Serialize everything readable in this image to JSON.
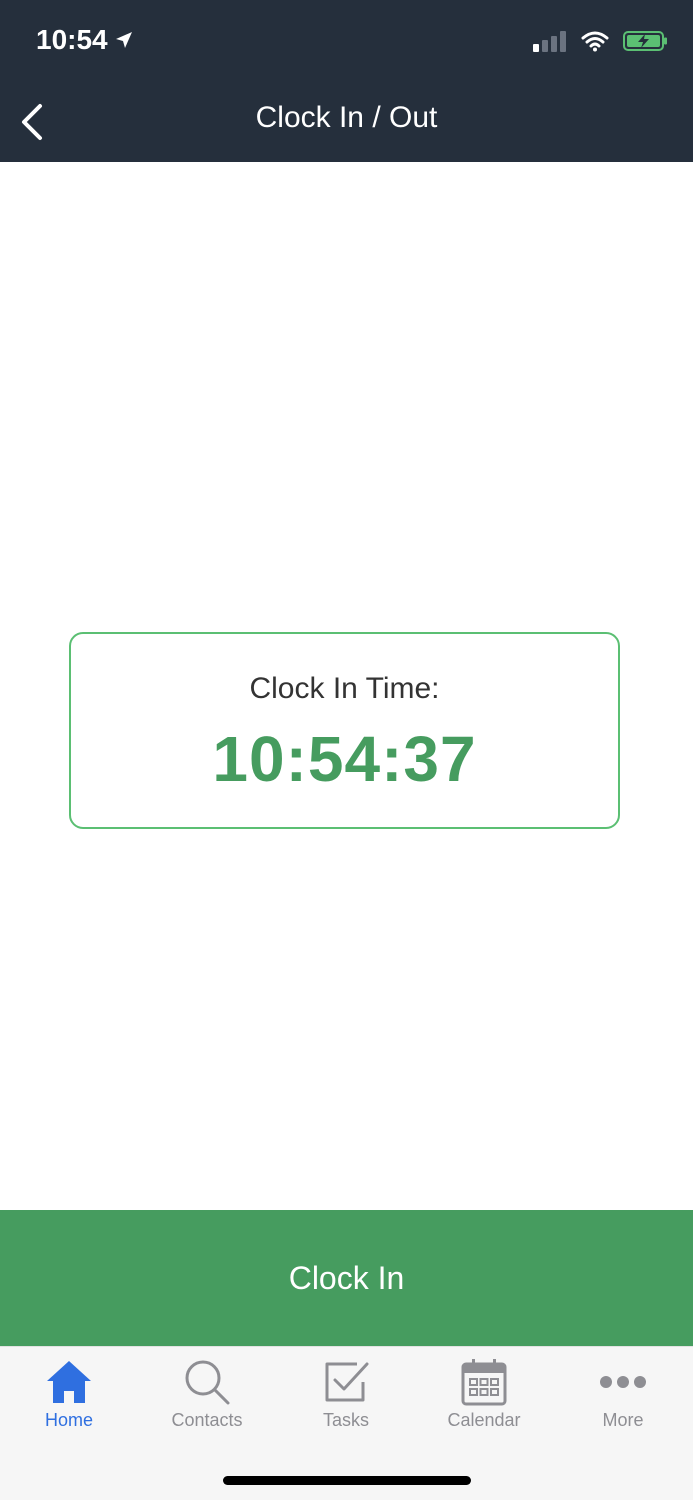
{
  "status_bar": {
    "time": "10:54"
  },
  "nav": {
    "title": "Clock In / Out"
  },
  "card": {
    "label": "Clock In Time:",
    "time": "10:54:37"
  },
  "action": {
    "label": "Clock In"
  },
  "tabs": [
    {
      "label": "Home",
      "icon": "home-icon",
      "active": true
    },
    {
      "label": "Contacts",
      "icon": "search-icon",
      "active": false
    },
    {
      "label": "Tasks",
      "icon": "checkbox-icon",
      "active": false
    },
    {
      "label": "Calendar",
      "icon": "calendar-icon",
      "active": false
    },
    {
      "label": "More",
      "icon": "more-icon",
      "active": false
    }
  ],
  "colors": {
    "header_bg": "#252f3c",
    "accent_green": "#469c5f",
    "card_border": "#5bbf73",
    "tab_active": "#2f6fe0",
    "tab_inactive": "#8e8e93"
  }
}
